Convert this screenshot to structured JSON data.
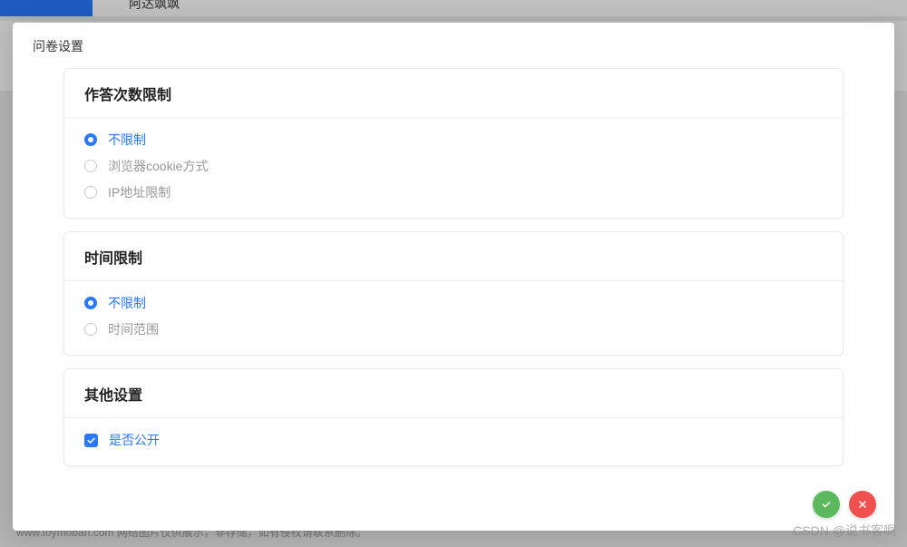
{
  "background": {
    "header_item": "阿达飒飒",
    "footer": "www.toymoban.com 网络图片仅供展示，非存储，如有侵权请联系删除。"
  },
  "modal": {
    "title": "问卷设置",
    "sections": {
      "answer_limit": {
        "title": "作答次数限制",
        "options": [
          {
            "label": "不限制",
            "checked": true
          },
          {
            "label": "浏览器cookie方式",
            "checked": false
          },
          {
            "label": "IP地址限制",
            "checked": false
          }
        ]
      },
      "time_limit": {
        "title": "时间限制",
        "options": [
          {
            "label": "不限制",
            "checked": true
          },
          {
            "label": "时间范围",
            "checked": false
          }
        ]
      },
      "other": {
        "title": "其他设置",
        "public": {
          "label": "是否公开",
          "checked": true
        }
      }
    }
  },
  "watermark": "CSDN @说书客啊"
}
